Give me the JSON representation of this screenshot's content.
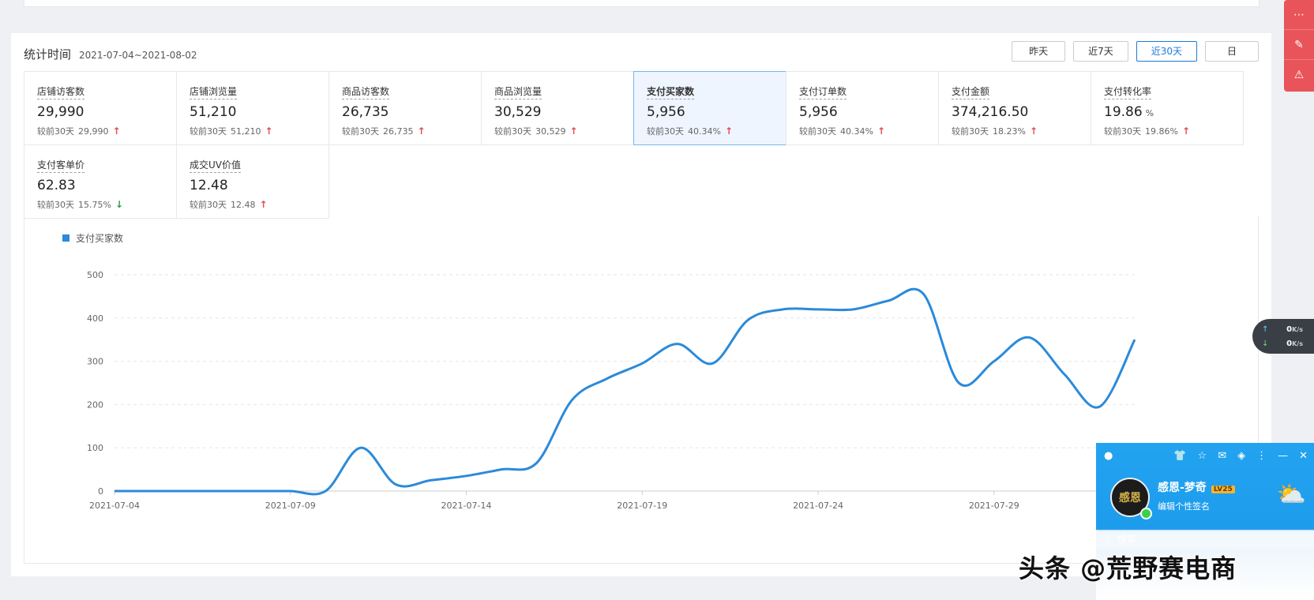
{
  "header": {
    "title": "统计时间",
    "date_range": "2021-07-04~2021-08-02"
  },
  "range_buttons": [
    {
      "label": "昨天",
      "active": false
    },
    {
      "label": "近7天",
      "active": false
    },
    {
      "label": "近30天",
      "active": true
    },
    {
      "label": "日",
      "active": false
    }
  ],
  "metrics": [
    {
      "label": "店铺访客数",
      "value": "29,990",
      "unit": "",
      "compare": "较前30天",
      "change": "29,990",
      "trend": "up",
      "selected": false
    },
    {
      "label": "店铺浏览量",
      "value": "51,210",
      "unit": "",
      "compare": "较前30天",
      "change": "51,210",
      "trend": "up",
      "selected": false
    },
    {
      "label": "商品访客数",
      "value": "26,735",
      "unit": "",
      "compare": "较前30天",
      "change": "26,735",
      "trend": "up",
      "selected": false
    },
    {
      "label": "商品浏览量",
      "value": "30,529",
      "unit": "",
      "compare": "较前30天",
      "change": "30,529",
      "trend": "up",
      "selected": false
    },
    {
      "label": "支付买家数",
      "value": "5,956",
      "unit": "",
      "compare": "较前30天",
      "change": "40.34%",
      "trend": "up",
      "selected": true
    },
    {
      "label": "支付订单数",
      "value": "5,956",
      "unit": "",
      "compare": "较前30天",
      "change": "40.34%",
      "trend": "up",
      "selected": false
    },
    {
      "label": "支付金额",
      "value": "374,216.50",
      "unit": "",
      "compare": "较前30天",
      "change": "18.23%",
      "trend": "up",
      "selected": false
    },
    {
      "label": "支付转化率",
      "value": "19.86",
      "unit": "%",
      "compare": "较前30天",
      "change": "19.86%",
      "trend": "up",
      "selected": false
    },
    {
      "label": "支付客单价",
      "value": "62.83",
      "unit": "",
      "compare": "较前30天",
      "change": "15.75%",
      "trend": "down",
      "selected": false
    },
    {
      "label": "成交UV价值",
      "value": "12.48",
      "unit": "",
      "compare": "较前30天",
      "change": "12.48",
      "trend": "up",
      "selected": false
    }
  ],
  "chart_data": {
    "type": "line",
    "title": "",
    "xlabel": "",
    "ylabel": "",
    "ylim": [
      0,
      500
    ],
    "yticks": [
      "0",
      "100",
      "200",
      "300",
      "400",
      "500"
    ],
    "xticks": [
      "2021-07-04",
      "2021-07-09",
      "2021-07-14",
      "2021-07-19",
      "2021-07-24",
      "2021-07-29"
    ],
    "grid": true,
    "legend_position": "top-left",
    "x": [
      "2021-07-04",
      "2021-07-05",
      "2021-07-06",
      "2021-07-07",
      "2021-07-08",
      "2021-07-09",
      "2021-07-10",
      "2021-07-11",
      "2021-07-12",
      "2021-07-13",
      "2021-07-14",
      "2021-07-15",
      "2021-07-16",
      "2021-07-17",
      "2021-07-18",
      "2021-07-19",
      "2021-07-20",
      "2021-07-21",
      "2021-07-22",
      "2021-07-23",
      "2021-07-24",
      "2021-07-25",
      "2021-07-26",
      "2021-07-27",
      "2021-07-28",
      "2021-07-29",
      "2021-07-30",
      "2021-07-31",
      "2021-08-01",
      "2021-08-02"
    ],
    "series": [
      {
        "name": "支付买家数",
        "color": "#2b8ad9",
        "values": [
          0,
          0,
          0,
          0,
          0,
          0,
          0,
          100,
          15,
          25,
          35,
          50,
          65,
          210,
          260,
          295,
          340,
          295,
          395,
          420,
          420,
          420,
          440,
          455,
          250,
          300,
          355,
          270,
          195,
          350
        ]
      }
    ]
  },
  "right_toolbar": {
    "icons": [
      "more-icon",
      "edit-icon",
      "warning-icon"
    ]
  },
  "net_widget": {
    "up": "0",
    "down": "0",
    "unit": "K/s"
  },
  "qq_panel": {
    "name": "感恩-梦奇",
    "level": "LV25",
    "signature": "编辑个性签名",
    "search_placeholder": "搜索"
  },
  "watermark": "头条 @荒野赛电商"
}
